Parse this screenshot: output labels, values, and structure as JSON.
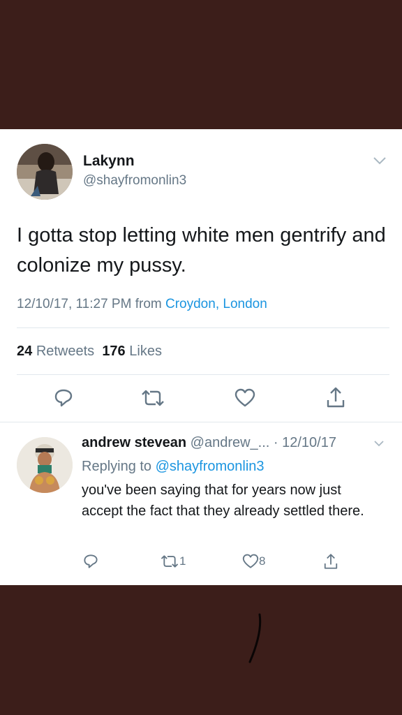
{
  "tweet": {
    "user_name": "Lakynn",
    "handle": "@shayfromonlin3",
    "text": "I gotta stop letting white men gentrify and colonize my pussy.",
    "timestamp": "12/10/17, 11:27 PM from",
    "location": "Croydon, London",
    "retweets_count": "24",
    "retweets_label": "Retweets",
    "likes_count": "176",
    "likes_label": "Likes"
  },
  "reply": {
    "user_name": "andrew stevean",
    "handle": "@andrew_... · 12/10/17",
    "replying_label": "Replying to",
    "replying_to": "@shayfromonlin3",
    "text": "you've been saying that for years now just accept the fact that they already settled there.",
    "retweet_count": "1",
    "like_count": "8"
  },
  "icons": [
    "reply-icon",
    "retweet-icon",
    "like-icon",
    "share-icon",
    "chevron-down-icon"
  ],
  "colors": {
    "background": "#3c1e1a",
    "link": "#1b95e0",
    "muted": "#657786",
    "text": "#14171a"
  }
}
